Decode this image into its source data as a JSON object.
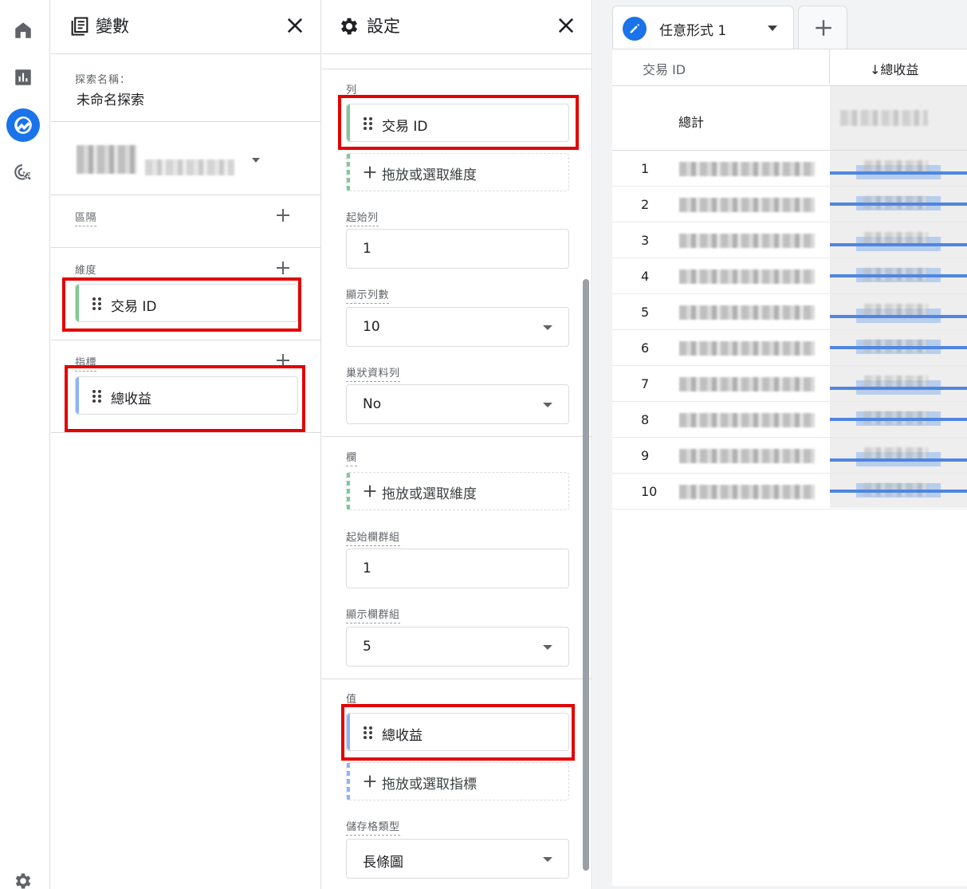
{
  "nav": {
    "items": [
      {
        "icon": "home-icon",
        "active": false
      },
      {
        "icon": "reports-icon",
        "active": false
      },
      {
        "icon": "explore-icon",
        "active": true
      },
      {
        "icon": "advertising-icon",
        "active": false
      }
    ],
    "settings_icon": "gear-icon"
  },
  "variables": {
    "title": "變數",
    "exploration_name_label": "探索名稱：",
    "exploration_name": "未命名探索",
    "segments_label": "區隔",
    "dimensions_label": "維度",
    "dimension_chip": "交易 ID",
    "metrics_label": "指標",
    "metric_chip": "總收益"
  },
  "settings": {
    "title": "設定",
    "rows_label": "列",
    "rows_chip": "交易 ID",
    "rows_drop": "拖放或選取維度",
    "start_row_label": "起始列",
    "start_row_value": "1",
    "show_rows_label": "顯示列數",
    "show_rows_value": "10",
    "nested_rows_label": "巢狀資料列",
    "nested_rows_value": "No",
    "columns_label": "欄",
    "columns_drop": "拖放或選取維度",
    "start_col_group_label": "起始欄群組",
    "start_col_group_value": "1",
    "show_col_groups_label": "顯示欄群組",
    "show_col_groups_value": "5",
    "values_label": "值",
    "values_chip": "總收益",
    "values_drop": "拖放或選取指標",
    "cell_type_label": "儲存格類型",
    "cell_type_value": "長條圖"
  },
  "canvas": {
    "tab_name": "任意形式 1",
    "col_dimension": "交易 ID",
    "col_metric": "↓總收益",
    "total_label": "總計",
    "rows": [
      "1",
      "2",
      "3",
      "4",
      "5",
      "6",
      "7",
      "8",
      "9",
      "10"
    ]
  },
  "colors": {
    "accent": "#1a73e8",
    "dimension_bar": "#81c995",
    "metric_bar": "#8ab4f8",
    "highlight": "#e30000"
  }
}
